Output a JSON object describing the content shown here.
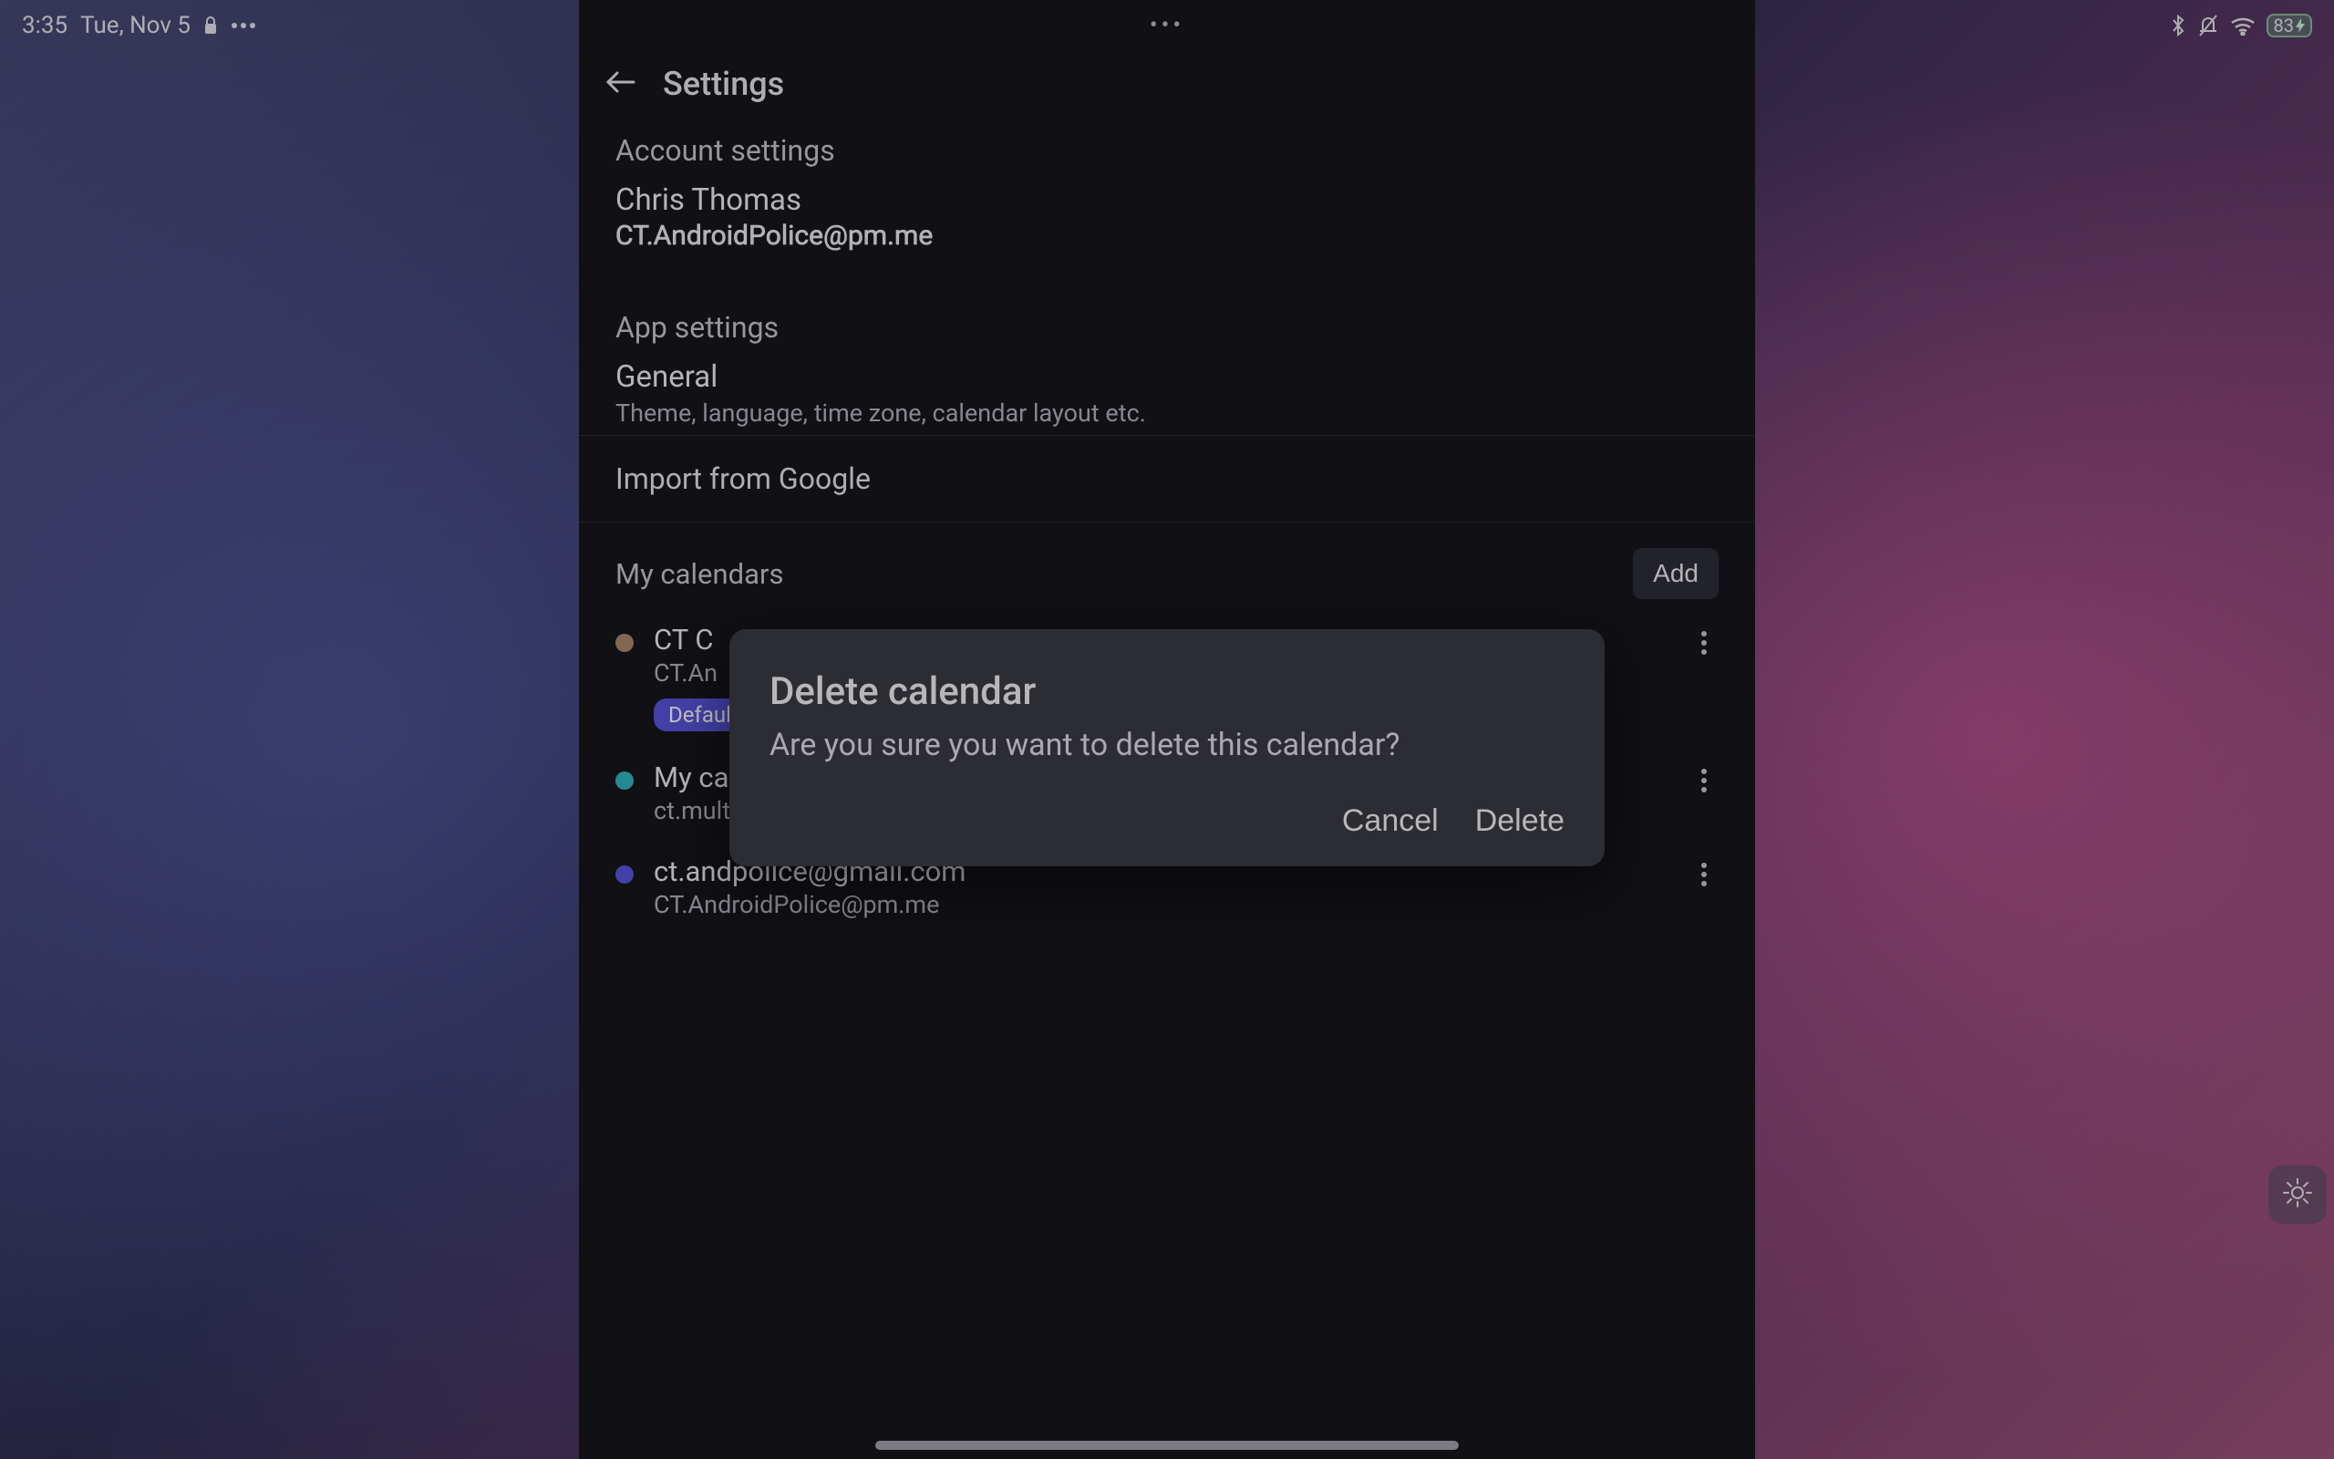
{
  "statusbar": {
    "time": "3:35",
    "date": "Tue, Nov 5",
    "battery_text": "83"
  },
  "settings_title": "Settings",
  "sections": {
    "account_heading": "Account settings",
    "account_name": "Chris Thomas",
    "account_email": "CT.AndroidPolice@pm.me",
    "app_heading": "App settings",
    "general_title": "General",
    "general_sub": "Theme, language, time zone, calendar layout etc.",
    "import_row": "Import from Google",
    "my_calendars_label": "My calendars",
    "add_label": "Add"
  },
  "calendars": [
    {
      "name": "CT C",
      "sub": "CT.An",
      "color": "#b08a6e",
      "default_chip": "Default"
    },
    {
      "name": "My calendar",
      "sub": "ct.multipurpose@protonmail.com",
      "color": "#2fb8c5"
    },
    {
      "name": "ct.andpolice@gmail.com",
      "sub": "CT.AndroidPolice@pm.me",
      "color": "#5b56e0"
    }
  ],
  "dialog": {
    "title": "Delete calendar",
    "message": "Are you sure you want to delete this calendar?",
    "cancel": "Cancel",
    "delete": "Delete"
  }
}
